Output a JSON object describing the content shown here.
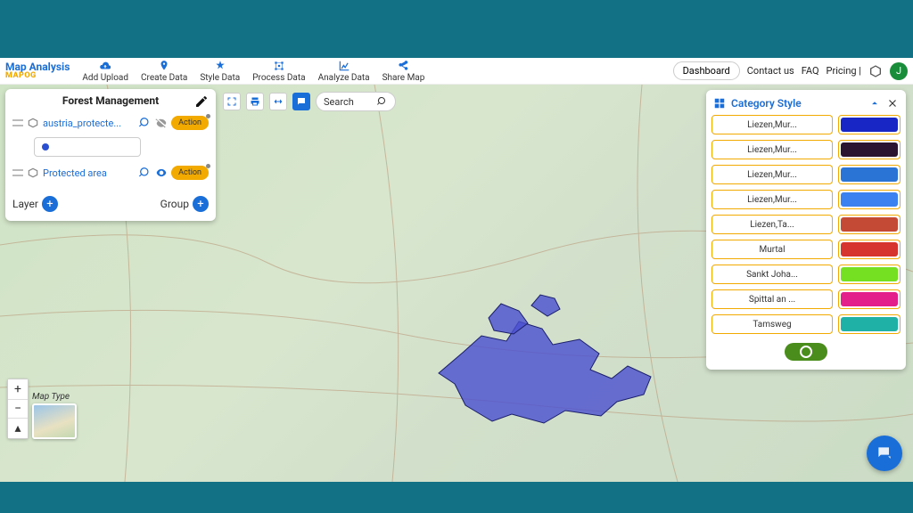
{
  "brand": {
    "line1": "Map Analysis",
    "line2": "MAPOG"
  },
  "nav": [
    {
      "label": "Add Upload",
      "icon": "cloud-upload-icon"
    },
    {
      "label": "Create Data",
      "icon": "pin-icon"
    },
    {
      "label": "Style Data",
      "icon": "style-icon"
    },
    {
      "label": "Process Data",
      "icon": "process-icon"
    },
    {
      "label": "Analyze Data",
      "icon": "analyze-icon"
    },
    {
      "label": "Share Map",
      "icon": "share-icon"
    }
  ],
  "topright": {
    "dashboard": "Dashboard",
    "contact": "Contact us",
    "faq": "FAQ",
    "pricing": "Pricing |",
    "avatar_letter": "J"
  },
  "left_panel": {
    "title": "Forest Management",
    "layers": [
      {
        "name": "austria_protecte...",
        "visible": false,
        "action": "Action"
      },
      {
        "name": "Protected area",
        "visible": true,
        "action": "Action"
      }
    ],
    "footer": {
      "layer": "Layer",
      "group": "Group"
    }
  },
  "map_tools": {
    "search": "Search"
  },
  "map_type_label": "Map Type",
  "right_panel": {
    "title": "Category Style",
    "categories": [
      {
        "name": "Liezen,Mur...",
        "color": "#1726c4"
      },
      {
        "name": "Liezen,Mur...",
        "color": "#2a1430"
      },
      {
        "name": "Liezen,Mur...",
        "color": "#2a74d6"
      },
      {
        "name": "Liezen,Mur...",
        "color": "#3b82f0"
      },
      {
        "name": "Liezen,Ta...",
        "color": "#c44a36"
      },
      {
        "name": "Murtal",
        "color": "#d6352f"
      },
      {
        "name": "Sankt Joha...",
        "color": "#74e021"
      },
      {
        "name": "Spittal an ...",
        "color": "#e21f8a"
      },
      {
        "name": "Tamsweg",
        "color": "#1fb1a6"
      }
    ]
  }
}
